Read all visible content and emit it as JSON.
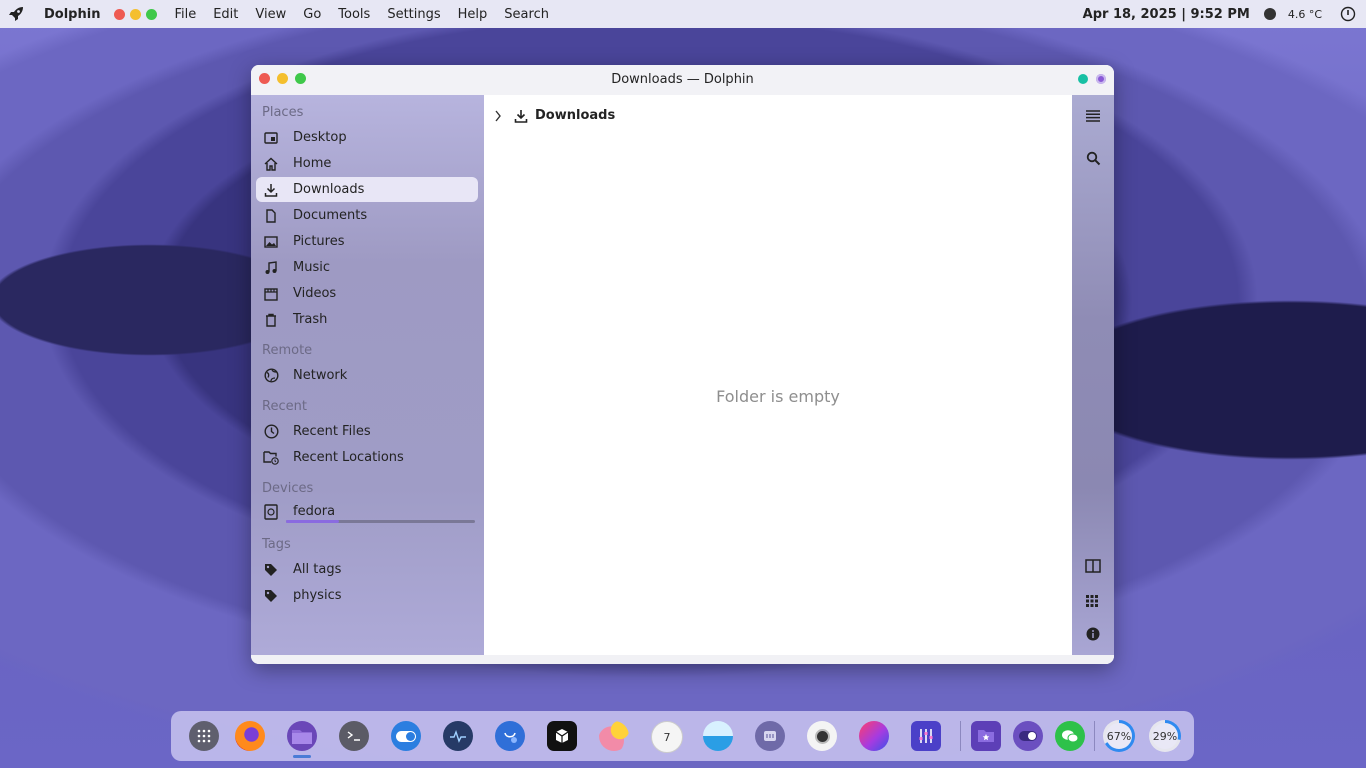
{
  "topbar": {
    "app_name": "Dolphin",
    "menu": [
      "File",
      "Edit",
      "View",
      "Go",
      "Tools",
      "Settings",
      "Help",
      "Search"
    ],
    "datetime": "Apr 18, 2025 | 9:52 PM",
    "temperature": "4.6 °C"
  },
  "window": {
    "title": "Downloads — Dolphin"
  },
  "sidebar": {
    "places_header": "Places",
    "places": [
      {
        "label": "Desktop",
        "icon": "desktop-icon"
      },
      {
        "label": "Home",
        "icon": "home-icon"
      },
      {
        "label": "Downloads",
        "icon": "download-icon",
        "selected": true
      },
      {
        "label": "Documents",
        "icon": "document-icon"
      },
      {
        "label": "Pictures",
        "icon": "picture-icon"
      },
      {
        "label": "Music",
        "icon": "music-icon"
      },
      {
        "label": "Videos",
        "icon": "video-icon"
      },
      {
        "label": "Trash",
        "icon": "trash-icon"
      }
    ],
    "remote_header": "Remote",
    "remote": [
      {
        "label": "Network",
        "icon": "network-icon"
      }
    ],
    "recent_header": "Recent",
    "recent": [
      {
        "label": "Recent Files",
        "icon": "clock-icon"
      },
      {
        "label": "Recent Locations",
        "icon": "folder-clock-icon"
      }
    ],
    "devices_header": "Devices",
    "devices": [
      {
        "label": "fedora",
        "icon": "drive-icon",
        "usage_fraction": 0.28
      }
    ],
    "tags_header": "Tags",
    "tags": [
      {
        "label": "All tags",
        "icon": "tag-icon"
      },
      {
        "label": "physics",
        "icon": "tag-icon"
      }
    ]
  },
  "main": {
    "breadcrumb": "Downloads",
    "empty_message": "Folder is empty"
  },
  "dock": {
    "cpu_label": "67%",
    "mem_label": "29%"
  },
  "colors": {
    "close": "#ee5a52",
    "minimize": "#f4bf2e",
    "maximize": "#3fc84a",
    "selection": "#e8e6f6",
    "accent_teal": "#18c0a4",
    "accent_purple": "#8a5ad6"
  }
}
